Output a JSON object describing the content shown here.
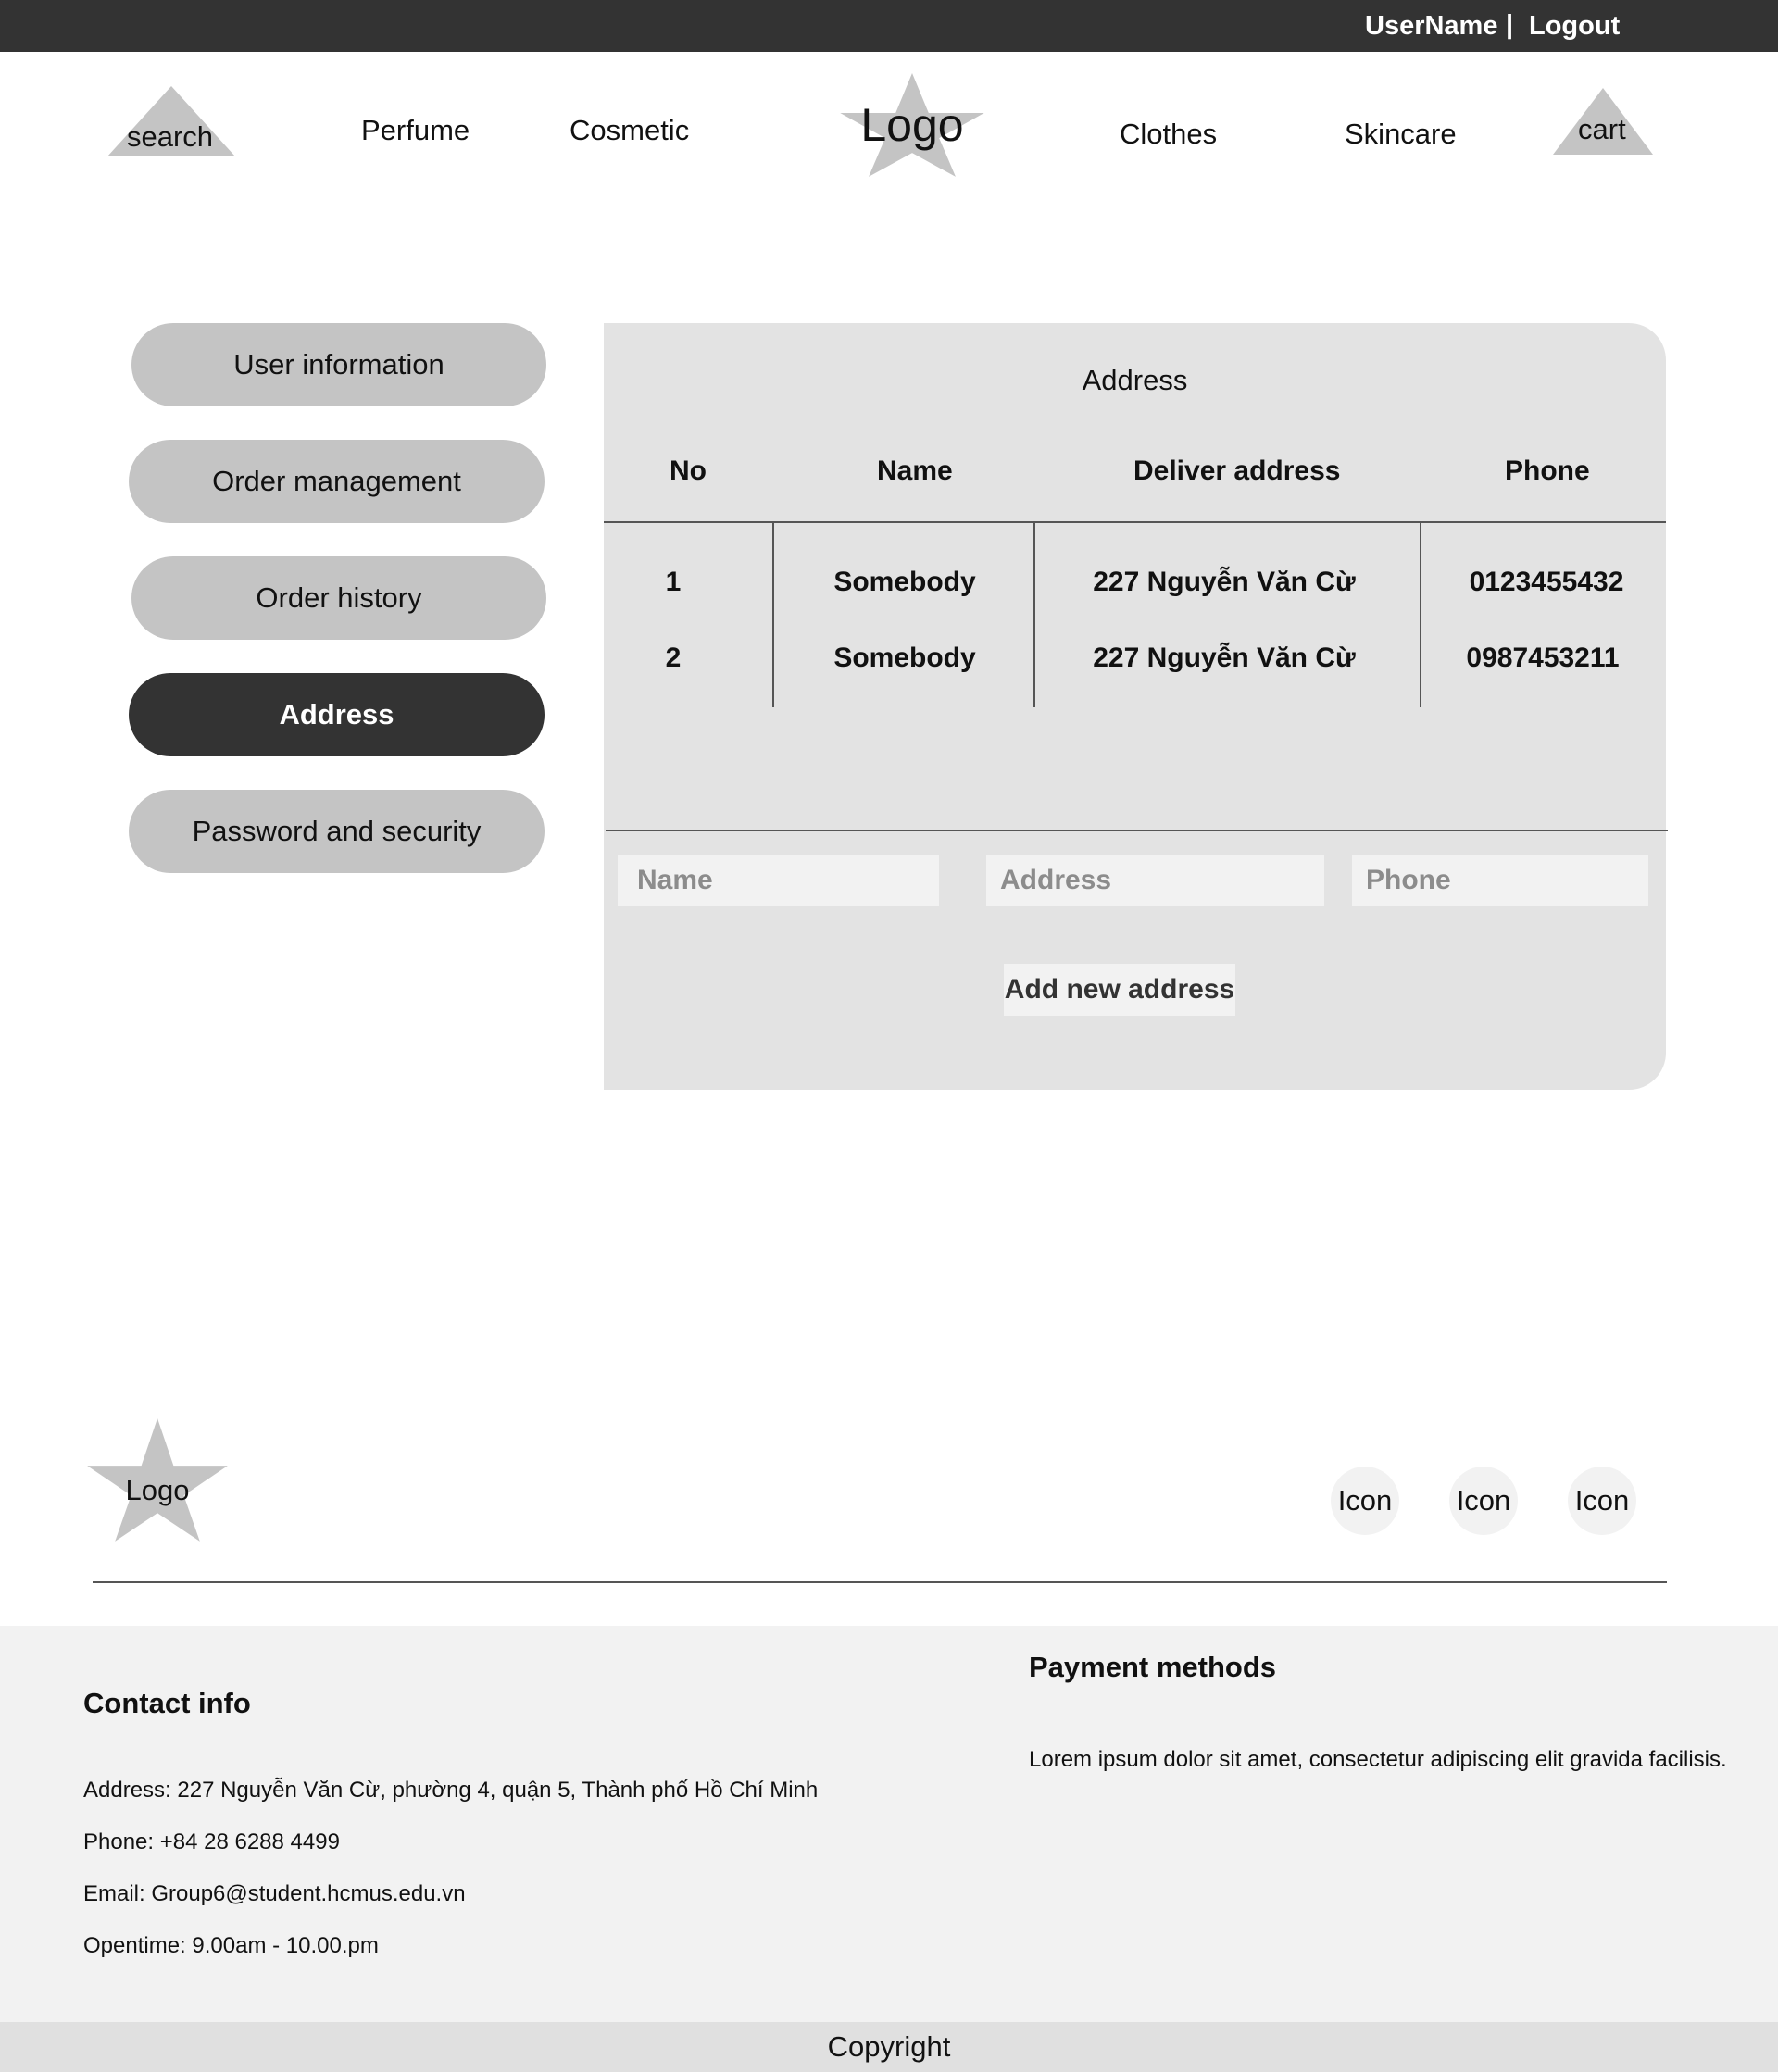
{
  "topbar": {
    "username": "UserName",
    "separator": "|",
    "logout": "Logout"
  },
  "nav": {
    "search": "search",
    "perfume": "Perfume",
    "cosmetic": "Cosmetic",
    "logo": "Logo",
    "clothes": "Clothes",
    "skincare": "Skincare",
    "cart": "cart"
  },
  "sidebar": {
    "items": [
      {
        "label": "User information"
      },
      {
        "label": "Order management"
      },
      {
        "label": "Order history"
      },
      {
        "label": "Address",
        "active": true
      },
      {
        "label": "Password and security"
      }
    ]
  },
  "address_panel": {
    "title": "Address",
    "columns": [
      "No",
      "Name",
      "Deliver address",
      "Phone"
    ],
    "rows": [
      [
        "1",
        "Somebody",
        "227 Nguyễn Văn Cừ",
        "0123455432"
      ],
      [
        "2",
        "Somebody",
        "227 Nguyễn Văn Cừ",
        "0987453211"
      ]
    ],
    "inputs": {
      "name_placeholder": "Name",
      "address_placeholder": "Address",
      "phone_placeholder": "Phone"
    },
    "add_button": "Add new address"
  },
  "footer": {
    "logo": "Logo",
    "icons": [
      "Icon",
      "Icon",
      "Icon"
    ],
    "contact": {
      "heading": "Contact info",
      "address": "Address: 227 Nguyễn Văn Cừ, phường 4, quận 5, Thành phố Hồ Chí Minh",
      "phone": "Phone: +84 28 6288 4499",
      "email": "Email: Group6@student.hcmus.edu.vn",
      "opentime": "Opentime: 9.00am - 10.00.pm"
    },
    "payment": {
      "heading": "Payment methods",
      "text": "Lorem ipsum dolor sit amet, consectetur adipiscing elit gravida facilisis."
    },
    "copyright": "Copyright"
  },
  "colors": {
    "dark": "#333333",
    "placeholder_shape": "#c4c4c4",
    "panel_bg": "#e3e3e3",
    "footer_bg": "#f2f2f2"
  }
}
